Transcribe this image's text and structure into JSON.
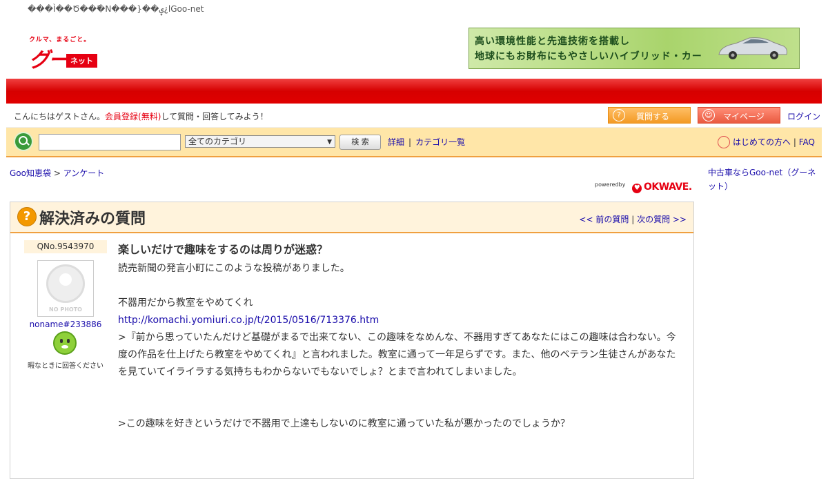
{
  "page": {
    "garbled_title": "���Ì��Ծ���ٌN���}��ۑ¿lGoo-net"
  },
  "logo": {
    "tagline": "クルマ、まるごと。",
    "goo": "グー",
    "net": "ネット"
  },
  "banner": {
    "line1": "高い環境性能と先進技術を搭載し",
    "line2": "地球にもお財布にもやさしいハイブリッド・カー"
  },
  "greeting": {
    "prefix": "こんにちはゲストさん。",
    "register_link": "会員登録(無料)",
    "suffix": "して質問・回答してみよう！",
    "ask_button": "質問する",
    "mypage_button": "マイページ",
    "login": "ログイン"
  },
  "search": {
    "input_value": "",
    "category_selected": "全てのカテゴリ",
    "button": "検 索",
    "detail_link": "詳細",
    "separator": "|",
    "category_list_link": "カテゴリ一覧",
    "first_time_link": "はじめての方へ",
    "faq_link": "FAQ"
  },
  "breadcrumb": {
    "root": "Goo知恵袋",
    "sep": ">",
    "current": "アンケート"
  },
  "powered": {
    "label": "poweredby",
    "brand": "OKWAVE."
  },
  "sidebar": {
    "link": "中古車ならGoo-net（グーネット）"
  },
  "question": {
    "heading": "解決済みの質問",
    "prev": "<< 前の質問",
    "nav_sep": "|",
    "next": "次の質問 >>",
    "number": "QNo.9543970",
    "avatar_text": "NO PHOTO",
    "user": "noname#233886",
    "user_status": "暇なときに回答ください",
    "title": "楽しいだけで趣味をするのは周りが迷惑？",
    "body": {
      "p1": "読売新聞の発言小町にこのような投稿がありました。",
      "p2": "不器用だから教室をやめてくれ",
      "url": "http://komachi.yomiuri.co.jp/t/2015/0516/713376.htm",
      "p3": ">『前から思っていたんだけど基礎がまるで出来てない、この趣味をなめんな、不器用すぎてあなたにはこの趣味は合わない。今度の作品を仕上げたら教室をやめてくれ』と言われました。教室に通って一年足らずです。また、他のベテラン生徒さんがあなたを見ていてイライラする気持ちもわからないでもないでしょ？とまで言われてしまいました。",
      "p4": ">この趣味を好きというだけで不器用で上達もしないのに教室に通っていた私が悪かったのでしょうか？"
    }
  }
}
